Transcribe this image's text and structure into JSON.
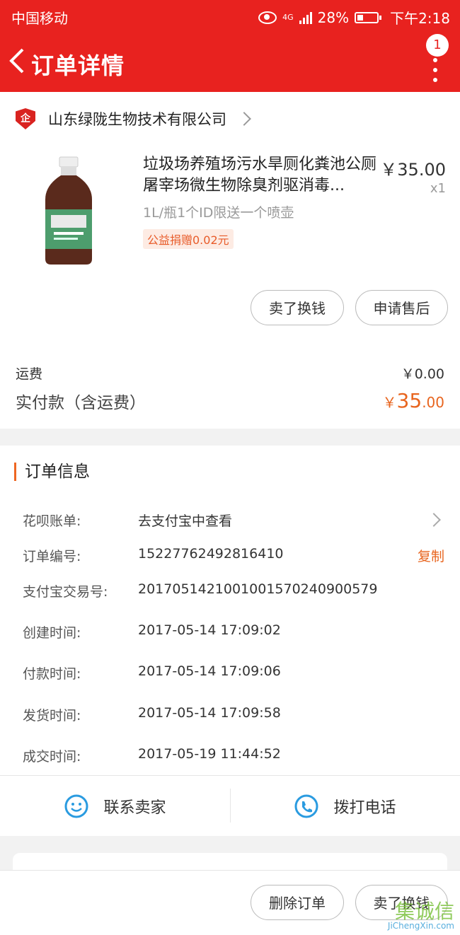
{
  "status_bar": {
    "carrier": "中国移动",
    "network": "4G",
    "battery": "28%",
    "time": "下午2:18"
  },
  "nav": {
    "title": "订单详情",
    "badge": "1"
  },
  "shop": {
    "logo_text": "企",
    "name": "山东绿陇生物技术有限公司"
  },
  "product": {
    "title": "垃圾场养殖场污水旱厕化粪池公厕屠宰场微生物除臭剂驱消毒...",
    "price": "￥35.00",
    "qty": "x1",
    "spec": "1L/瓶1个ID限送一个喷壶",
    "donation": "公益捐赠0.02元"
  },
  "buttons_top": {
    "sell": "卖了换钱",
    "after_sale": "申请售后"
  },
  "fees": {
    "shipping_label": "运费",
    "shipping_value": "￥0.00",
    "total_label": "实付款（含运费）",
    "total_currency": "￥",
    "total_int": "35",
    "total_dec": ".00"
  },
  "order_info": {
    "title": "订单信息",
    "rows": [
      {
        "label": "花呗账单:",
        "value": "去支付宝中查看"
      },
      {
        "label": "订单编号:",
        "value": "15227762492816410",
        "action": "复制"
      },
      {
        "label": "支付宝交易号:",
        "value": "2017051421001001570240900579"
      },
      {
        "label": "创建时间:",
        "value": "2017-05-14 17:09:02"
      },
      {
        "label": "付款时间:",
        "value": "2017-05-14 17:09:06"
      },
      {
        "label": "发货时间:",
        "value": "2017-05-14 17:09:58"
      },
      {
        "label": "成交时间:",
        "value": "2017-05-19 11:44:52"
      }
    ]
  },
  "contact": {
    "seller": "联系卖家",
    "call": "拨打电话"
  },
  "bottom": {
    "delete": "删除订单",
    "sell": "卖了换钱"
  },
  "watermark": {
    "cn": "集诚信",
    "en": "JiChengXin.com"
  },
  "colors": {
    "brand_red": "#e8221f",
    "accent_orange": "#e8651f",
    "icon_blue": "#2a9be0"
  }
}
